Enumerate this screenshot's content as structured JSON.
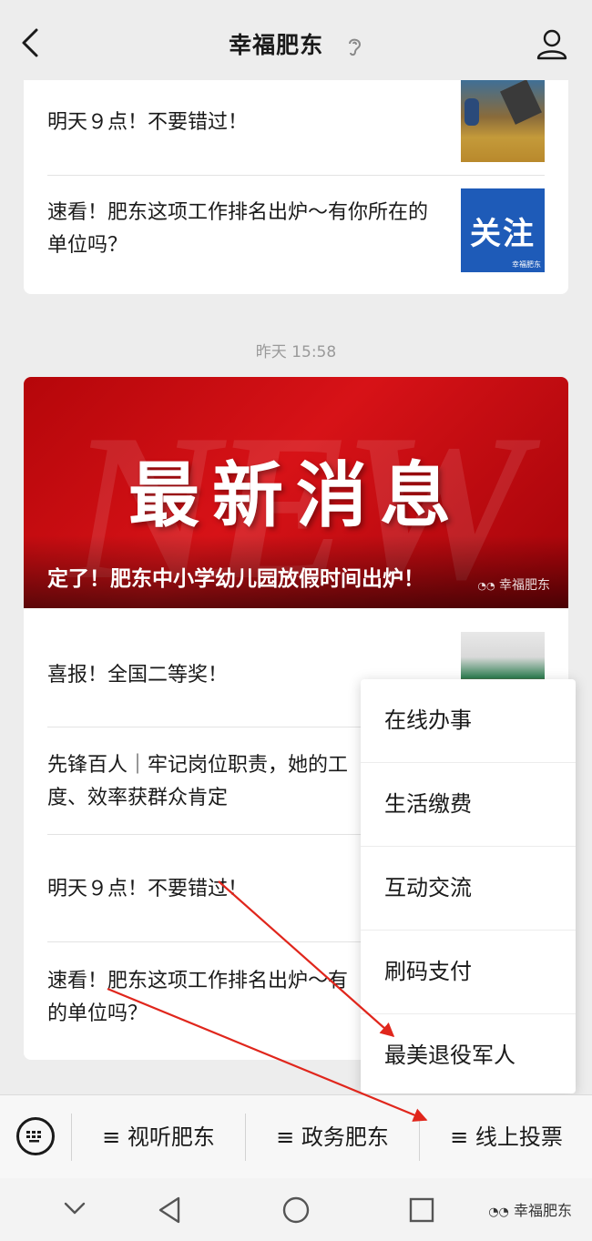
{
  "header": {
    "title": "幸福肥东"
  },
  "card1": {
    "items": [
      {
        "text": "明天９点！不要错过！"
      },
      {
        "text": "速看！肥东这项工作排名出炉～有你所在的单位吗？",
        "thumb_text": "关注",
        "thumb_sub": "幸福肥东"
      }
    ]
  },
  "timestamp": "昨天 15:58",
  "card2": {
    "banner_bg_word": "NEW",
    "banner_headline": "最新消息",
    "banner_caption": "定了！肥东中小学幼儿园放假时间出炉！",
    "banner_watermark": "幸福肥东",
    "items": [
      {
        "text": "喜报！全国二等奖！"
      },
      {
        "text_line1": "先锋百人｜牢记岗位职责，她的工",
        "text_line2": "度、效率获群众肯定"
      },
      {
        "text": "明天９点！不要错过！"
      },
      {
        "text_line1": "速看！肥东这项工作排名出炉～有",
        "text_line2": "的单位吗？"
      }
    ]
  },
  "popup_menu": {
    "items": [
      "在线办事",
      "生活缴费",
      "互动交流",
      "刷码支付",
      "最美退役军人"
    ]
  },
  "bottom_menu": {
    "items": [
      "≡ 视听肥东",
      "≡ 政务肥东",
      "≡ 线上投票"
    ]
  },
  "watermark": "幸福肥东",
  "colors": {
    "banner_red": "#d71217",
    "arrow_red": "#e0261c",
    "background": "#ededed"
  }
}
